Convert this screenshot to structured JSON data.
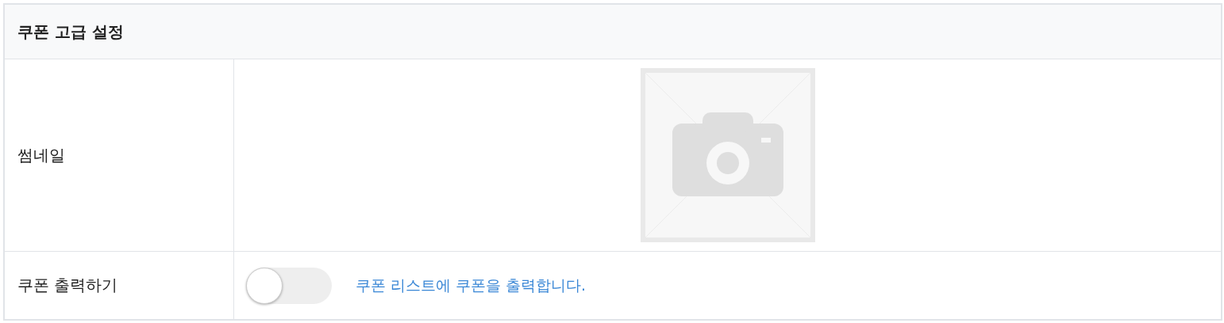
{
  "panel": {
    "title": "쿠폰 고급 설정"
  },
  "rows": [
    {
      "kind": "image",
      "label": "썸네일"
    },
    {
      "kind": "toggle",
      "label": "쿠폰 출력하기",
      "on": false,
      "hint": "쿠폰 리스트에 쿠폰을 출력합니다."
    }
  ]
}
